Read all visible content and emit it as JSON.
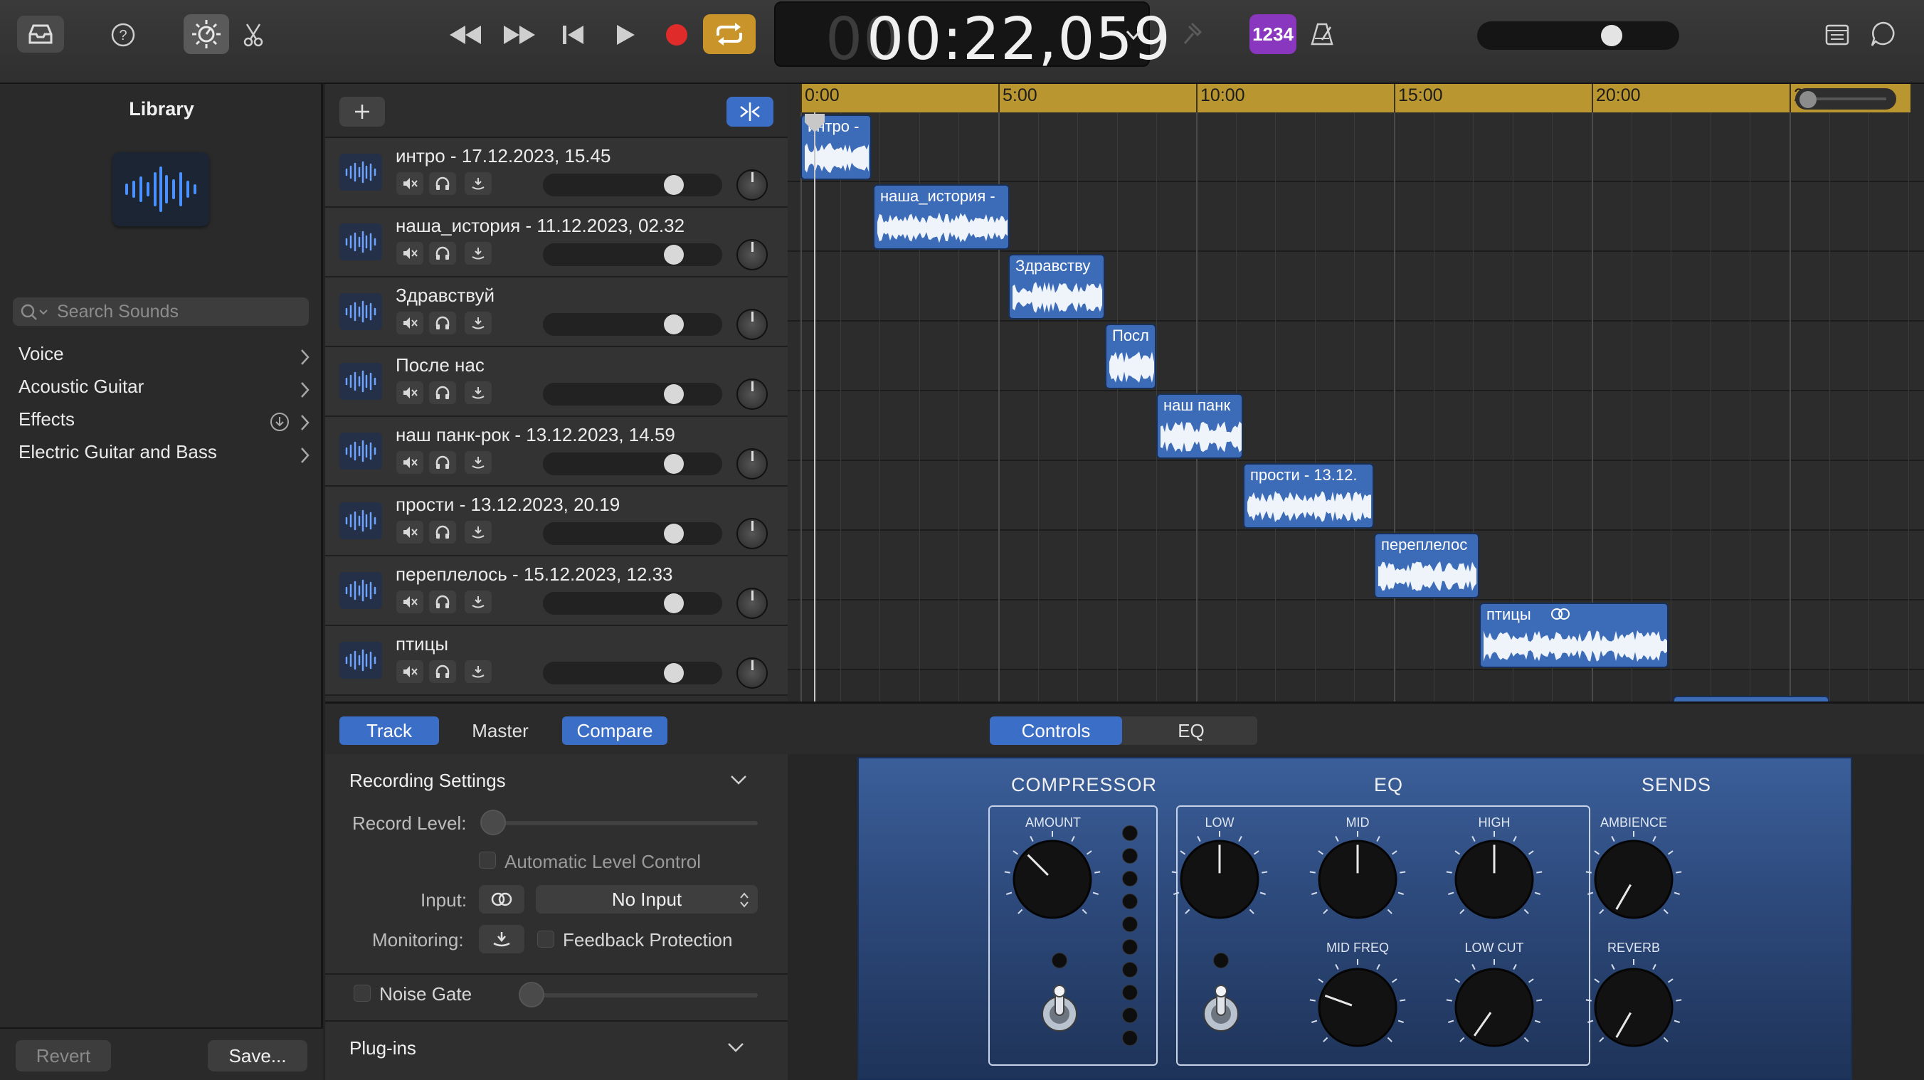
{
  "transport": {
    "lcd_dim": "00",
    "lcd_time": "00:22,059",
    "count_in": "1234"
  },
  "library": {
    "title": "Library",
    "search_placeholder": "Search Sounds",
    "items": [
      {
        "label": "Voice"
      },
      {
        "label": "Acoustic Guitar"
      },
      {
        "label": "Effects"
      },
      {
        "label": "Electric Guitar and Bass"
      }
    ],
    "revert_label": "Revert",
    "save_label": "Save..."
  },
  "ruler": {
    "labels": [
      "0:00",
      "5:00",
      "10:00",
      "15:00",
      "20:00",
      "25:00"
    ]
  },
  "tracks": [
    {
      "name": "интро - 17.12.2023, 15.45",
      "region_label": "интро -"
    },
    {
      "name": "наша_история - 11.12.2023, 02.32",
      "region_label": "наша_история -"
    },
    {
      "name": "Здравствуй",
      "region_label": "Здравству"
    },
    {
      "name": "После нас",
      "region_label": "Посл"
    },
    {
      "name": "наш панк-рок - 13.12.2023, 14.59",
      "region_label": "наш панк"
    },
    {
      "name": "прости - 13.12.2023, 20.19",
      "region_label": "прости - 13.12."
    },
    {
      "name": "переплелось - 15.12.2023, 12.33",
      "region_label": "переплелос"
    },
    {
      "name": "птицы",
      "region_label": "птицы"
    }
  ],
  "bottom_tabs": {
    "track": "Track",
    "master": "Master",
    "compare": "Compare",
    "controls": "Controls",
    "eq": "EQ"
  },
  "recording": {
    "title": "Recording Settings",
    "record_level_label": "Record Level:",
    "auto_level_label": "Automatic Level Control",
    "input_label": "Input:",
    "input_value": "No Input",
    "monitoring_label": "Monitoring:",
    "feedback_label": "Feedback Protection",
    "noise_gate_label": "Noise Gate",
    "plugins_label": "Plug-ins"
  },
  "plugin": {
    "compressor_title": "COMPRESSOR",
    "eq_title": "EQ",
    "sends_title": "SENDS",
    "amount_label": "AMOUNT",
    "low_label": "LOW",
    "mid_label": "MID",
    "high_label": "HIGH",
    "mid_freq_label": "MID FREQ",
    "low_cut_label": "LOW CUT",
    "ambience_label": "AMBIENCE",
    "reverb_label": "REVERB"
  },
  "colors": {
    "accent_blue": "#3b6ec6",
    "record_red": "#e02b2b",
    "cycle_yellow": "#c9952a",
    "ruler_gold": "#b9962f",
    "region_blue": "#3c6bb8"
  }
}
